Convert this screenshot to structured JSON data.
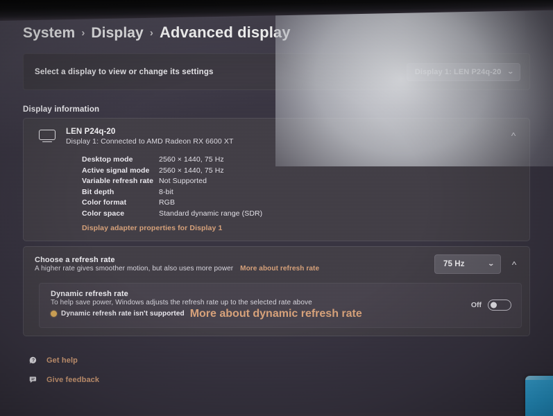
{
  "breadcrumb": {
    "items": [
      "System",
      "Display",
      "Advanced display"
    ],
    "separator": "›"
  },
  "select_band": {
    "label": "Select a display to view or change its settings",
    "display_picker": {
      "value": "Display 1: LEN P24q-20",
      "chevron": "⌄"
    }
  },
  "display_information": {
    "section_label": "Display information",
    "monitor_name": "LEN P24q-20",
    "connection": "Display 1: Connected to AMD Radeon RX 6600 XT",
    "expander_chevron": "˄",
    "specs": [
      {
        "key": "Desktop mode",
        "value": "2560 × 1440, 75 Hz"
      },
      {
        "key": "Active signal mode",
        "value": "2560 × 1440, 75 Hz"
      },
      {
        "key": "Variable refresh rate",
        "value": "Not Supported"
      },
      {
        "key": "Bit depth",
        "value": "8-bit"
      },
      {
        "key": "Color format",
        "value": "RGB"
      },
      {
        "key": "Color space",
        "value": "Standard dynamic range (SDR)"
      }
    ],
    "adapter_link": "Display adapter properties for Display 1"
  },
  "refresh_rate": {
    "title": "Choose a refresh rate",
    "description": "A higher rate gives smoother motion, but also uses more power",
    "more_link": "More about refresh rate",
    "value": "75 Hz",
    "chevron": "⌄",
    "expander_chevron": "˄"
  },
  "dynamic_refresh_rate": {
    "title": "Dynamic refresh rate",
    "description": "To help save power, Windows adjusts the refresh rate up to the selected rate above",
    "warning": "Dynamic refresh rate isn't supported",
    "more_link": "More about dynamic refresh rate",
    "toggle_state": "Off"
  },
  "footer": {
    "get_help": "Get help",
    "give_feedback": "Give feedback"
  },
  "colors": {
    "accent_link": "#d8a27a",
    "page_background": "#373340",
    "card_background": "#423e46",
    "warning": "#e0b05c",
    "flyout_blue": "#2bb2f0"
  }
}
